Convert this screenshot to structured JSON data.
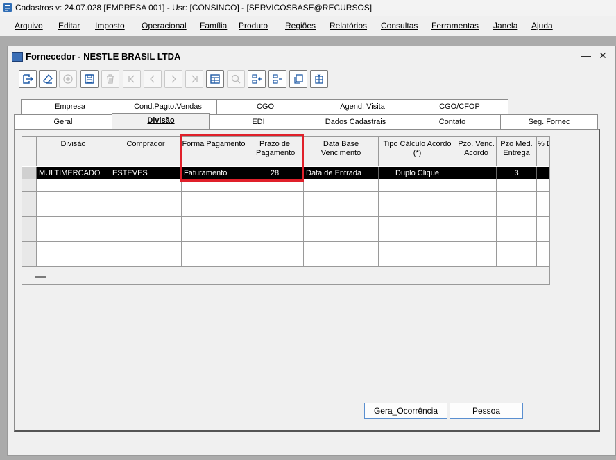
{
  "app": {
    "title": "Cadastros  v: 24.07.028   [EMPRESA 001] - Usr: [CONSINCO] - [SERVICOSBASE@RECURSOS]"
  },
  "menu": [
    "Arquivo",
    "Editar",
    "Imposto",
    "Operacional",
    "Família",
    "Produto",
    "Regiões",
    "Relatórios",
    "Consultas",
    "Ferramentas",
    "Janela",
    "Ajuda"
  ],
  "window": {
    "title": "Fornecedor - NESTLE BRASIL LTDA",
    "minimize": "—",
    "close": "✕"
  },
  "toolbar": [
    "exit-icon",
    "eraser-icon",
    "add-icon",
    "save-icon",
    "delete-icon",
    "first-icon",
    "prev-icon",
    "next-icon",
    "last-icon",
    "grid-icon",
    "search-icon",
    "insert-row-icon",
    "remove-row-icon",
    "copy-icon",
    "columns-icon"
  ],
  "tabs_row1": [
    "Empresa",
    "Cond.Pagto.Vendas",
    "CGO",
    "Agend. Visita",
    "CGO/CFOP"
  ],
  "tabs_row2": [
    "Geral",
    "Divisão",
    "EDI",
    "Dados Cadastrais",
    "Contato",
    "Seg. Fornec"
  ],
  "active_tab": "Divisão",
  "grid": {
    "headers": [
      "Divisão",
      "Comprador",
      "Forma Pagamento",
      "Prazo de Pagamento",
      "Data Base Vencimento",
      "Tipo Cálculo Acordo (*)",
      "Pzo. Venc. Acordo",
      "Pzo Méd. Entrega",
      "% De"
    ],
    "rows": [
      [
        "MULTIMERCADO",
        "ESTEVES",
        "Faturamento",
        "28",
        "Data de Entrada",
        "Duplo Clique",
        "",
        "3",
        ""
      ]
    ]
  },
  "buttons": {
    "gera": "Gera_Ocorrência",
    "pessoa": "Pessoa"
  }
}
